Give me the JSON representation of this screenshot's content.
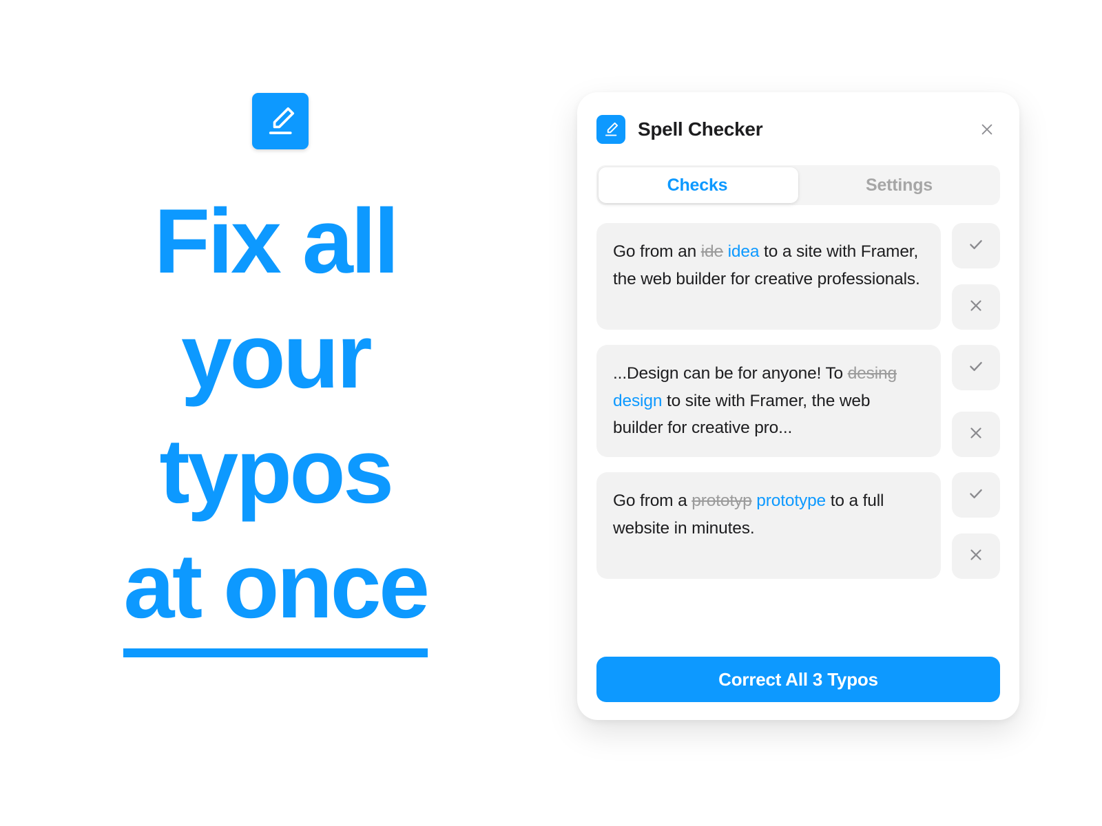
{
  "hero": {
    "icon": "pencil-edit-icon",
    "headline_lines": [
      "Fix all",
      "your",
      "typos",
      "at once"
    ],
    "underlined_line_index": 3,
    "accent_color": "#0D99FF"
  },
  "panel": {
    "badge_icon": "pencil-edit-icon",
    "title": "Spell Checker",
    "close_icon": "close-icon",
    "tabs": [
      {
        "label": "Checks",
        "active": true
      },
      {
        "label": "Settings",
        "active": false
      }
    ],
    "checks": [
      {
        "prefix": "Go from an ",
        "typo": "ide",
        "suggestion": "idea",
        "suffix": " to a site with Framer, the web builder for creative professionals.",
        "accept_icon": "check-icon",
        "reject_icon": "close-icon"
      },
      {
        "prefix": "...Design can be for anyone! To ",
        "typo": "desing",
        "suggestion": "design",
        "suffix": " to site with Framer, the web builder for creative pro...",
        "accept_icon": "check-icon",
        "reject_icon": "close-icon"
      },
      {
        "prefix": "Go from a ",
        "typo": "prototyp",
        "suggestion": "prototype",
        "suffix": " to a full website in minutes.",
        "accept_icon": "check-icon",
        "reject_icon": "close-icon"
      }
    ],
    "primary_button": "Correct All 3 Typos",
    "colors": {
      "accent": "#0D99FF",
      "card_fill": "#F2F2F2",
      "track_fill": "#F4F4F4",
      "typo_text": "#9B9B9B",
      "muted_text": "#A6A6A6",
      "body_text": "#1D1D1F"
    }
  }
}
